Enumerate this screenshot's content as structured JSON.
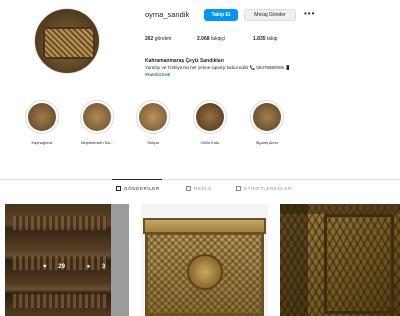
{
  "profile": {
    "username": "oyma_sandik",
    "follow_label": "Takip Et",
    "message_label": "Mesaj Gönder",
    "more_label": "•••",
    "stats": {
      "posts": {
        "count": "262",
        "label": "gönderi"
      },
      "followers": {
        "count": "2.068",
        "label": "takipçi"
      },
      "following": {
        "count": "1.835",
        "label": "takip"
      }
    },
    "bio": {
      "name": "Kahramanmaraş Çeyiz Sandıkları",
      "line": "Yurtdışı ve Türkiye'nin her yerine siparişi kabul edilir 📞 05378690006 📱",
      "hashtag": "#kutuhizmeti"
    }
  },
  "highlights": [
    {
      "label": "Kaynağımız",
      "color": "#7a5a33"
    },
    {
      "label": "Müşterimizin Sa...",
      "color": "#8f6b3e"
    },
    {
      "label": "Sehpa",
      "color": "#9a7a45"
    },
    {
      "label": "Gelin Kutu",
      "color": "#6e4a28"
    },
    {
      "label": "Sipariş Alınır",
      "color": "#7d5c36"
    }
  ],
  "tabs": [
    {
      "label": "GÖNDERİLER",
      "active": true
    },
    {
      "label": "REELS",
      "active": false
    },
    {
      "label": "ETİKETLENENLER",
      "active": false
    }
  ],
  "posts": [
    {
      "likes": "29",
      "comments": "3"
    },
    {},
    {}
  ]
}
